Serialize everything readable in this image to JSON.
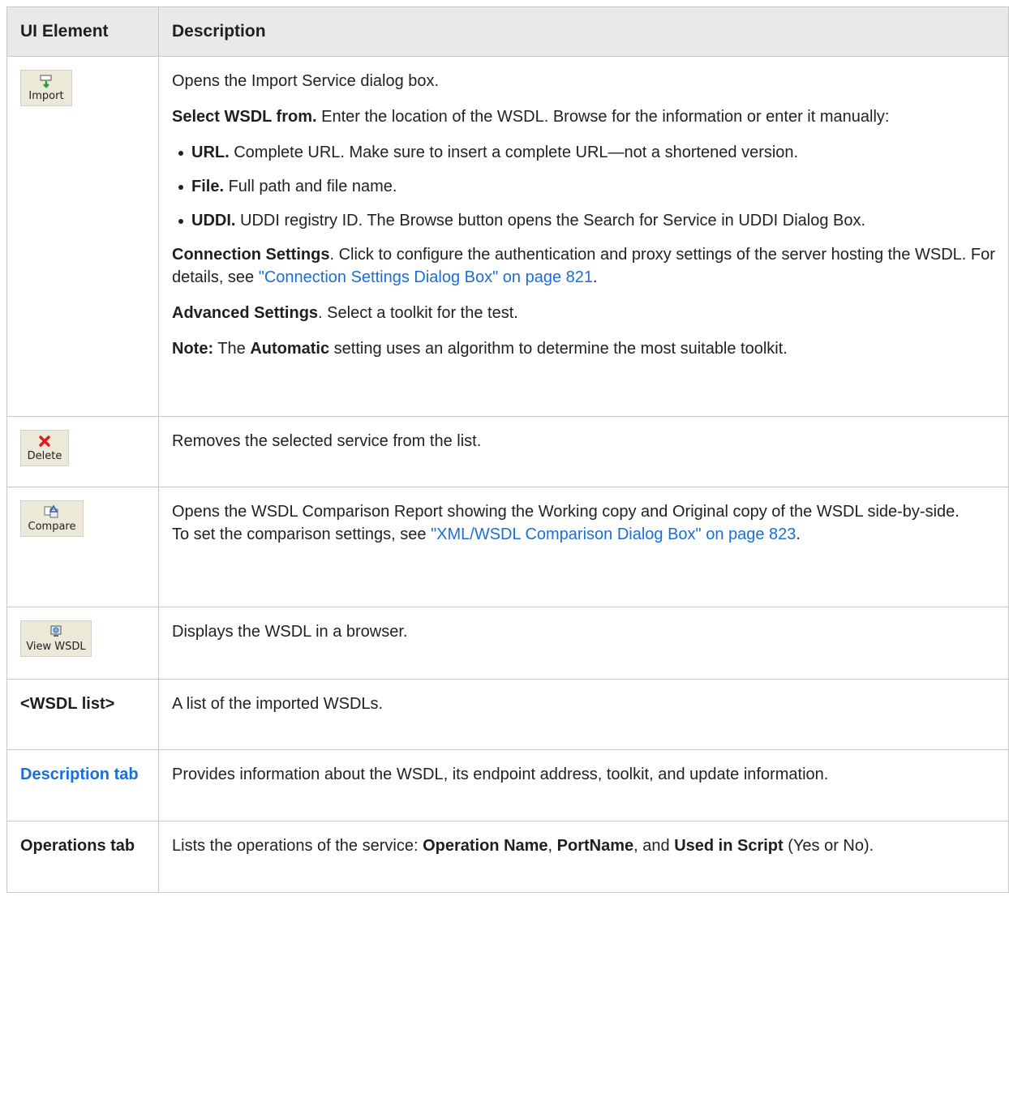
{
  "header": {
    "col1": "UI Element",
    "col2": "Description"
  },
  "rows": {
    "import": {
      "button_label": "Import",
      "icon": "import-icon",
      "p1": "Opens the Import Service dialog box.",
      "select_bold": "Select WSDL from.",
      "select_text": " Enter the location of the WSDL. Browse for the information or enter it manually:",
      "bullets": [
        {
          "bold": "URL.",
          "text": " Complete URL. Make sure to insert a complete URL—not a shortened version."
        },
        {
          "bold": "File.",
          "text": " Full path and file name."
        },
        {
          "bold": "UDDI.",
          "text": " UDDI registry ID. The Browse button opens the Search for Service in UDDI Dialog Box."
        }
      ],
      "conn_bold": "Connection Settings",
      "conn_text": ". Click to configure the authentication and proxy settings of the server hosting the WSDL. For details, see ",
      "conn_link": "\"Connection Settings Dialog Box\" on page 821",
      "conn_end": ".",
      "adv_bold": "Advanced Settings",
      "adv_text": ". Select a toolkit for the test.",
      "note_bold": "Note:",
      "note_text1": " The ",
      "note_bold2": "Automatic",
      "note_text2": " setting uses an algorithm to determine the most suitable toolkit."
    },
    "delete": {
      "button_label": "Delete",
      "icon": "delete-icon",
      "desc": "Removes the selected service from the list."
    },
    "compare": {
      "button_label": "Compare",
      "icon": "compare-icon",
      "desc1": "Opens the WSDL Comparison Report showing the Working copy and Original copy of the WSDL side-by-side.",
      "desc2": "To set the comparison settings, see ",
      "link": "\"XML/WSDL Comparison Dialog Box\" on page 823",
      "end": "."
    },
    "view": {
      "button_label": "View WSDL",
      "icon": "view-wsdl-icon",
      "desc": "Displays the WSDL in a browser."
    },
    "list": {
      "label": "<WSDL list>",
      "desc": "A list of the imported WSDLs."
    },
    "description_tab": {
      "label": "Description tab",
      "desc": "Provides information about the WSDL, its endpoint address, toolkit, and update information."
    },
    "operations_tab": {
      "label": "Operations tab",
      "desc_a": "Lists the operations of the service: ",
      "b1": "Operation Name",
      "sep1": ", ",
      "b2": "PortName",
      "sep2": ", and ",
      "b3": "Used in Script",
      "desc_b": " (Yes or No)."
    }
  }
}
